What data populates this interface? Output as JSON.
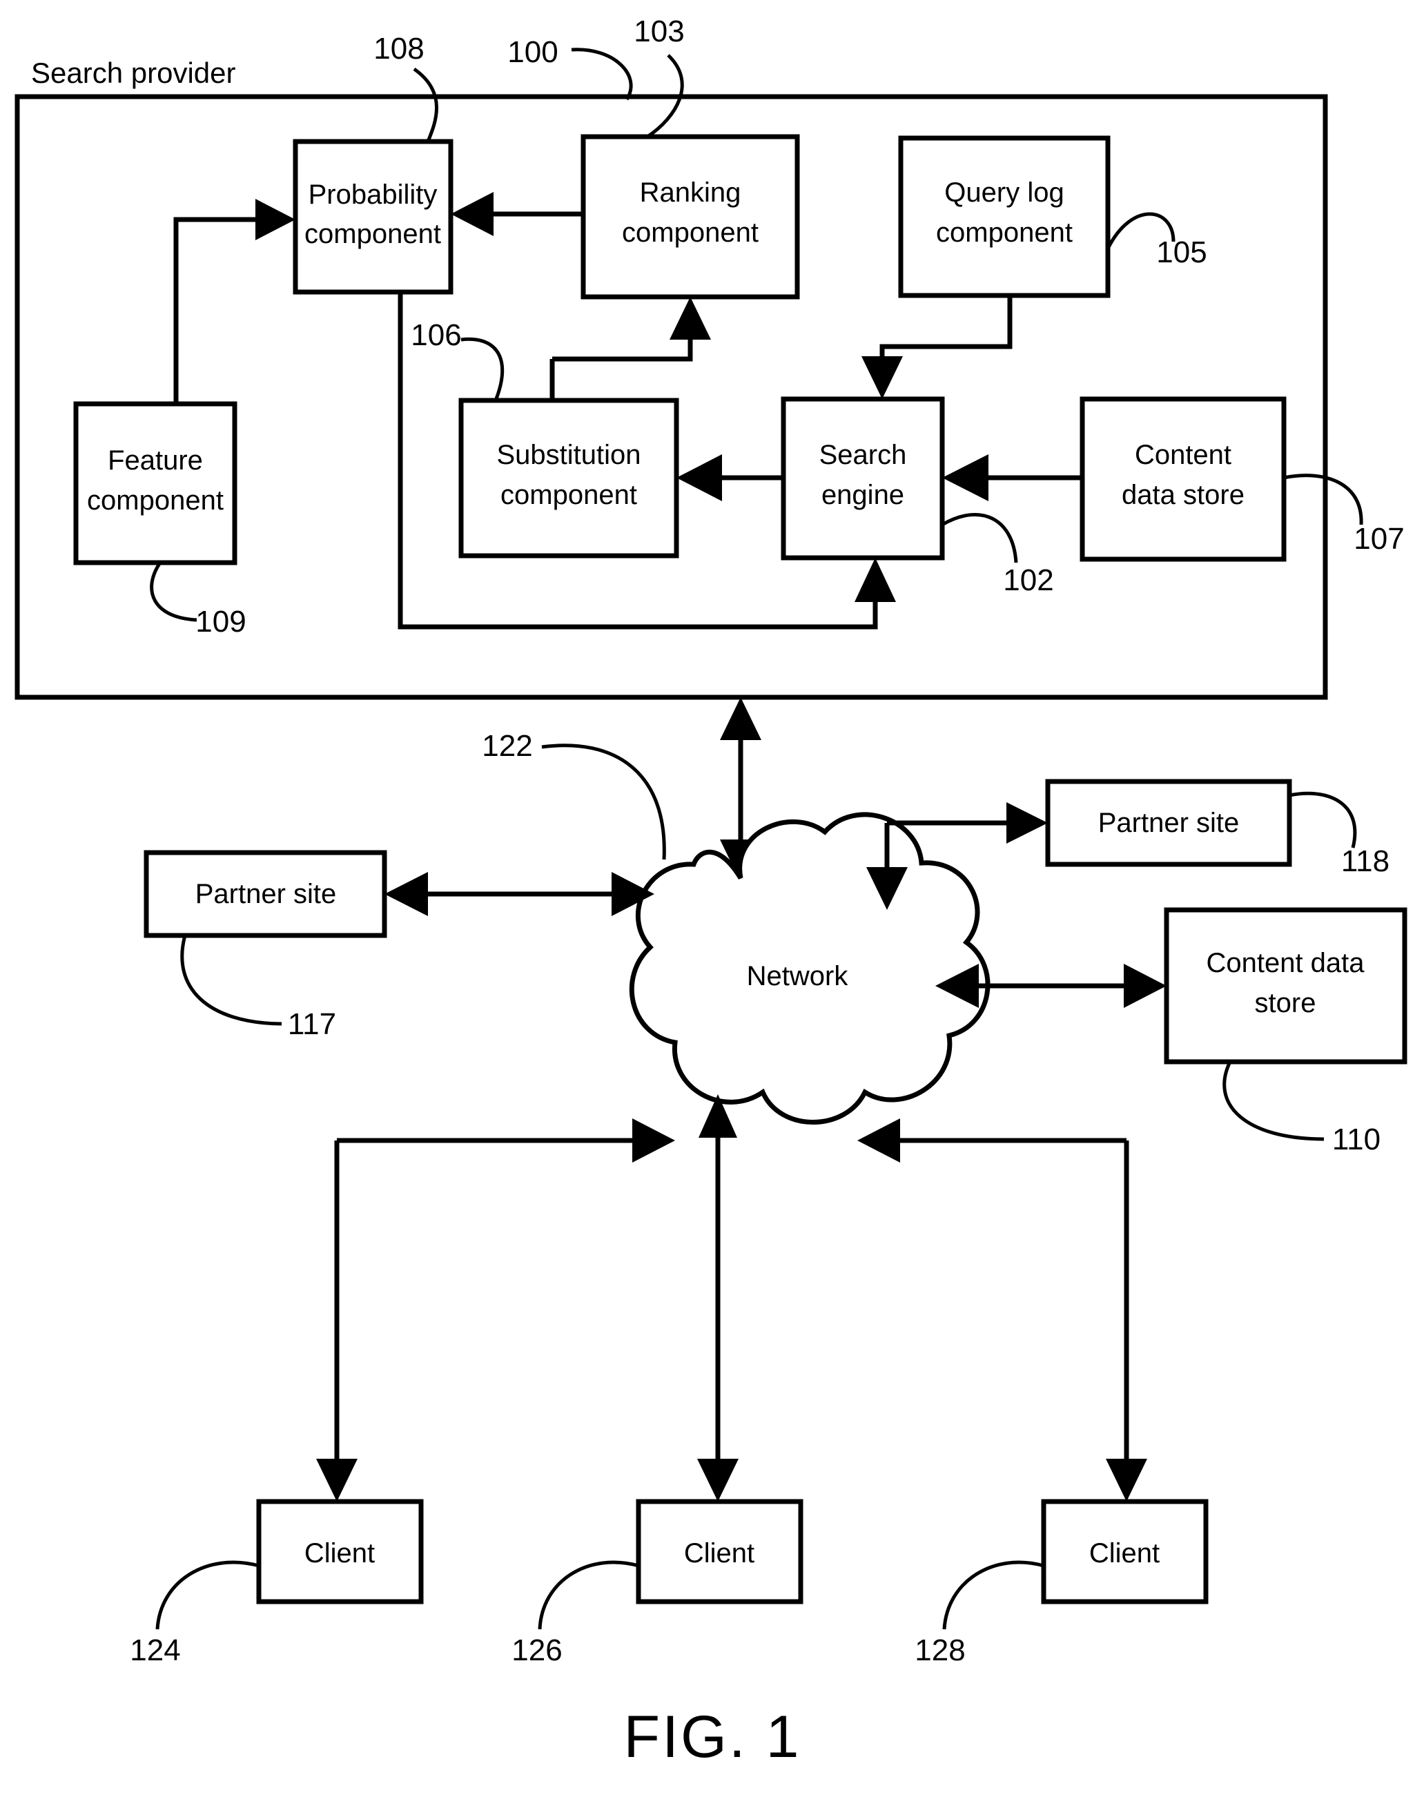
{
  "figure": {
    "caption": "FIG. 1",
    "section_label": "Search provider"
  },
  "boxes": [
    {
      "id": "probability",
      "label_line1": "Probability",
      "label_line2": "component",
      "ref": "108"
    },
    {
      "id": "ranking",
      "label_line1": "Ranking",
      "label_line2": "component",
      "ref": "103"
    },
    {
      "id": "query_log",
      "label_line1": "Query log",
      "label_line2": "component",
      "ref": "105"
    },
    {
      "id": "feature",
      "label_line1": "Feature",
      "label_line2": "component",
      "ref": "109"
    },
    {
      "id": "substitution",
      "label_line1": "Substitution",
      "label_line2": "component",
      "ref": "106"
    },
    {
      "id": "search_engine",
      "label_line1": "Search",
      "label_line2": "engine",
      "ref": "102"
    },
    {
      "id": "content_store_in",
      "label_line1": "Content",
      "label_line2": "data store",
      "ref": "107"
    },
    {
      "id": "partner_site_left",
      "label_line1": "Partner site",
      "label_line2": "",
      "ref": "117"
    },
    {
      "id": "partner_site_right",
      "label_line1": "Partner site",
      "label_line2": "",
      "ref": "118"
    },
    {
      "id": "content_store_out",
      "label_line1": "Content data",
      "label_line2": "store",
      "ref": "110"
    },
    {
      "id": "client_1",
      "label_line1": "Client",
      "label_line2": "",
      "ref": "124"
    },
    {
      "id": "client_2",
      "label_line1": "Client",
      "label_line2": "",
      "ref": "126"
    },
    {
      "id": "client_3",
      "label_line1": "Client",
      "label_line2": "",
      "ref": "128"
    }
  ],
  "cloud": {
    "label": "Network",
    "ref": "122"
  },
  "system_ref": "100",
  "colors": {
    "ink": "#000000",
    "paper": "#ffffff"
  }
}
